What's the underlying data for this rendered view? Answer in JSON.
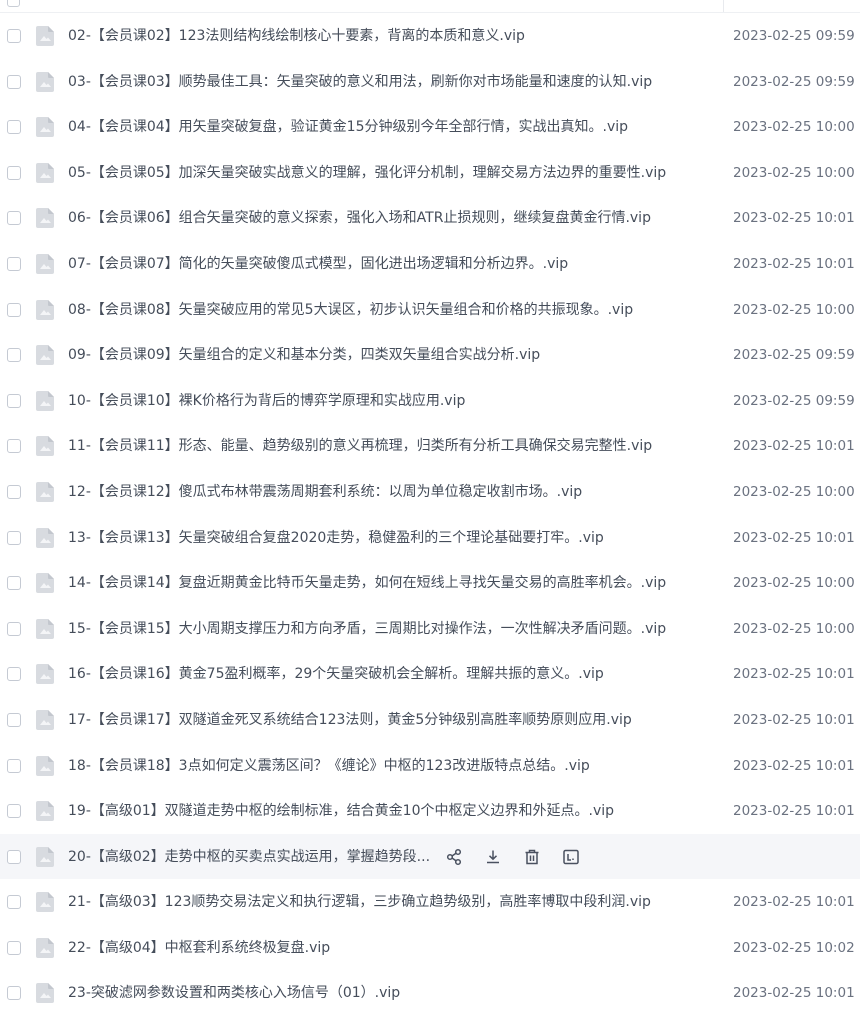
{
  "files": [
    {
      "name": "02-【会员课02】123法则结构线绘制核心十要素，背离的本质和意义.vip",
      "time": "2023-02-25 09:59"
    },
    {
      "name": "03-【会员课03】顺势最佳工具：矢量突破的意义和用法，刷新你对市场能量和速度的认知.vip",
      "time": "2023-02-25 09:59"
    },
    {
      "name": "04-【会员课04】用矢量突破复盘，验证黄金15分钟级别今年全部行情，实战出真知。.vip",
      "time": "2023-02-25 10:00"
    },
    {
      "name": "05-【会员课05】加深矢量突破实战意义的理解，强化评分机制，理解交易方法边界的重要性.vip",
      "time": "2023-02-25 10:00"
    },
    {
      "name": "06-【会员课06】组合矢量突破的意义探索，强化入场和ATR止损规则，继续复盘黄金行情.vip",
      "time": "2023-02-25 10:01"
    },
    {
      "name": "07-【会员课07】简化的矢量突破傻瓜式模型，固化进出场逻辑和分析边界。.vip",
      "time": "2023-02-25 10:01"
    },
    {
      "name": "08-【会员课08】矢量突破应用的常见5大误区，初步认识矢量组合和价格的共振现象。.vip",
      "time": "2023-02-25 10:00"
    },
    {
      "name": "09-【会员课09】矢量组合的定义和基本分类，四类双矢量组合实战分析.vip",
      "time": "2023-02-25 09:59"
    },
    {
      "name": "10-【会员课10】裸K价格行为背后的博弈学原理和实战应用.vip",
      "time": "2023-02-25 09:59"
    },
    {
      "name": "11-【会员课11】形态、能量、趋势级别的意义再梳理，归类所有分析工具确保交易完整性.vip",
      "time": "2023-02-25 10:01"
    },
    {
      "name": "12-【会员课12】傻瓜式布林带震荡周期套利系统：以周为单位稳定收割市场。.vip",
      "time": "2023-02-25 10:00"
    },
    {
      "name": "13-【会员课13】矢量突破组合复盘2020走势，稳健盈利的三个理论基础要打牢。.vip",
      "time": "2023-02-25 10:01"
    },
    {
      "name": "14-【会员课14】复盘近期黄金比特币矢量走势，如何在短线上寻找矢量交易的高胜率机会。.vip",
      "time": "2023-02-25 10:00"
    },
    {
      "name": "15-【会员课15】大小周期支撑压力和方向矛盾，三周期比对操作法，一次性解决矛盾问题。.vip",
      "time": "2023-02-25 10:00"
    },
    {
      "name": "16-【会员课16】黄金75盈利概率，29个矢量突破机会全解析。理解共振的意义。.vip",
      "time": "2023-02-25 10:01"
    },
    {
      "name": "17-【会员课17】双隧道金死叉系统结合123法则，黄金5分钟级别高胜率顺势原则应用.vip",
      "time": "2023-02-25 10:01"
    },
    {
      "name": "18-【会员课18】3点如何定义震荡区间？《缠论》中枢的123改进版特点总结。.vip",
      "time": "2023-02-25 10:01"
    },
    {
      "name": "19-【高级01】双隧道走势中枢的绘制标准，结合黄金10个中枢定义边界和外延点。.vip",
      "time": "2023-02-25 10:01"
    },
    {
      "name": "20-【高级02】走势中枢的买卖点实战运用，掌握趋势段...",
      "time": "",
      "hovered": true
    },
    {
      "name": "21-【高级03】123顺势交易法定义和执行逻辑，三步确立趋势级别，高胜率博取中段利润.vip",
      "time": "2023-02-25 10:01"
    },
    {
      "name": "22-【高级04】中枢套利系统终极复盘.vip",
      "time": "2023-02-25 10:02"
    },
    {
      "name": "23-突破滤网参数设置和两类核心入场信号（01）.vip",
      "time": "2023-02-25 10:01"
    }
  ],
  "hover_actions": [
    {
      "name": "share-icon"
    },
    {
      "name": "download-icon"
    },
    {
      "name": "delete-icon"
    },
    {
      "name": "rename-icon"
    }
  ],
  "colors": {
    "text": "#454d5a",
    "time": "#6b7280",
    "hover_bg": "#f5f6f9",
    "icon": "#d4d7dd"
  }
}
